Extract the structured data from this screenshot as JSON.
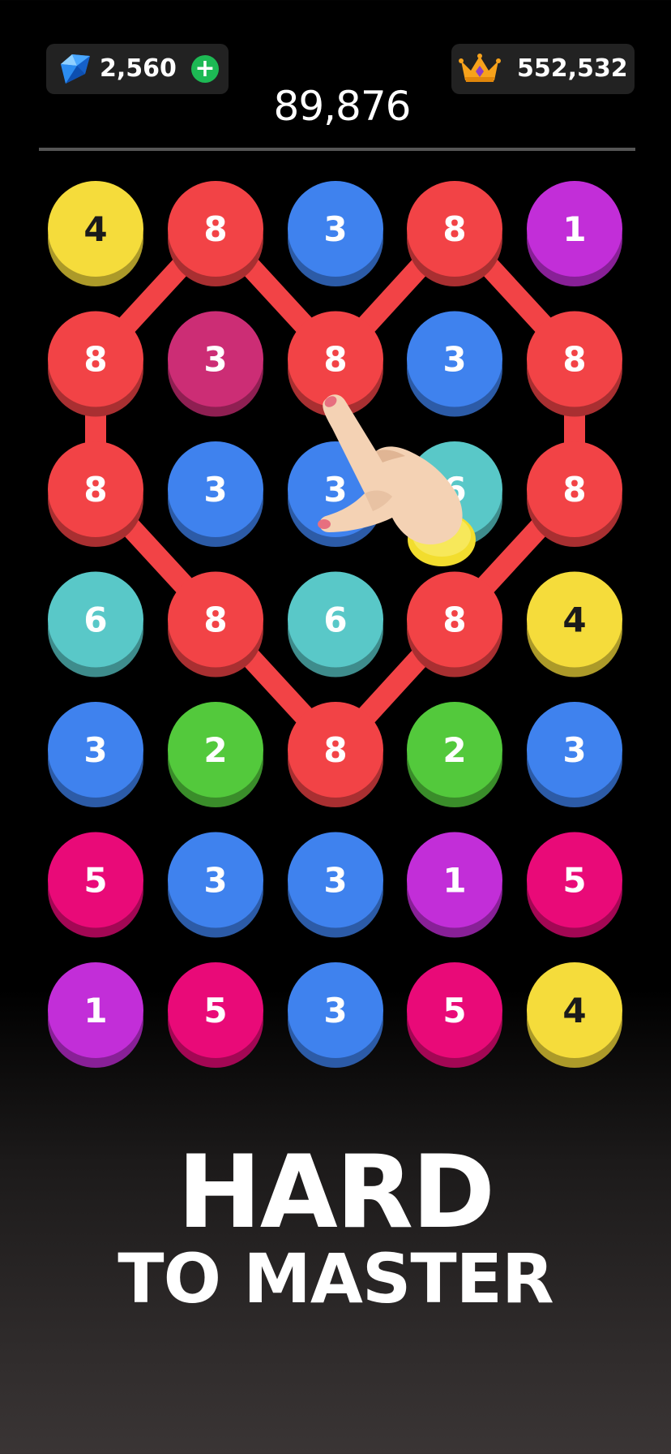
{
  "header": {
    "gems": {
      "value": "2,560",
      "icon": "gem-icon",
      "add_icon": "plus-icon",
      "add_color": "#1db954"
    },
    "best_score": {
      "value": "552,532",
      "icon": "crown-icon"
    },
    "score": "89,876"
  },
  "board": {
    "rows": 7,
    "cols": 5,
    "tiles": [
      [
        4,
        8,
        3,
        8,
        1
      ],
      [
        8,
        3,
        8,
        3,
        8
      ],
      [
        8,
        3,
        3,
        6,
        8
      ],
      [
        6,
        8,
        6,
        8,
        4
      ],
      [
        3,
        2,
        8,
        2,
        3
      ],
      [
        5,
        3,
        3,
        1,
        5
      ],
      [
        1,
        5,
        3,
        5,
        4
      ]
    ],
    "tile_colors": {
      "1": "#c22ed8",
      "2": "#53c93c",
      "3": "#3f82ee",
      "4": "#f5dc3b",
      "5": "#e90a78",
      "6": "#59c8c8",
      "8": "#f24346"
    },
    "special_tile_colors": [
      {
        "row": 1,
        "col": 1,
        "color": "#cc2d75"
      }
    ],
    "dark_text_values": [
      4
    ],
    "chain_color": "#f24346",
    "connection_chain": [
      [
        1,
        2
      ],
      [
        0,
        1
      ],
      [
        1,
        0
      ],
      [
        2,
        0
      ],
      [
        3,
        1
      ],
      [
        4,
        2
      ],
      [
        3,
        3
      ],
      [
        2,
        4
      ],
      [
        1,
        4
      ],
      [
        0,
        3
      ],
      [
        1,
        2
      ]
    ],
    "hint_icon": "pointing-hand-icon"
  },
  "tagline": {
    "line1": "HARD",
    "line2": "TO MASTER"
  }
}
